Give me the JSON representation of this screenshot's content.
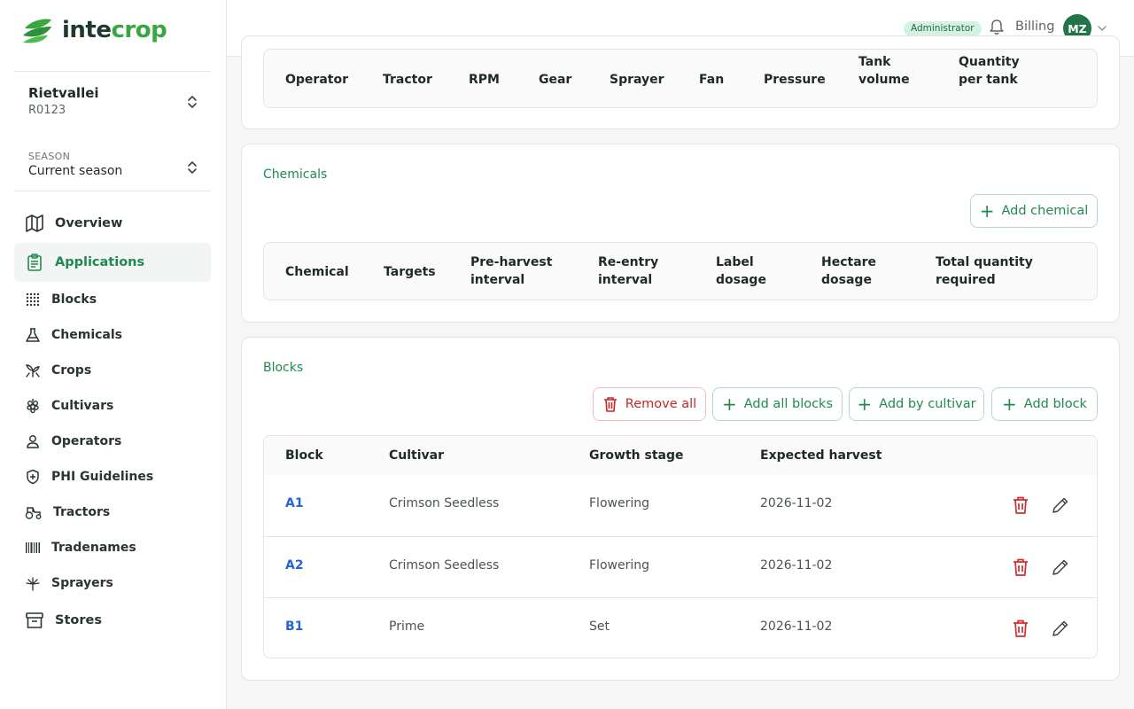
{
  "app": {
    "logo": {
      "prefix": "inte",
      "suffix": "crop"
    }
  },
  "sidebar": {
    "farm": {
      "name": "Rietvallei",
      "code": "R0123"
    },
    "season": {
      "label": "SEASON",
      "value": "Current season"
    },
    "items": [
      {
        "label": "Overview",
        "icon": "map-icon"
      },
      {
        "label": "Applications",
        "icon": "clipboard-icon",
        "active": true
      },
      {
        "label": "Blocks",
        "icon": "grid-icon"
      },
      {
        "label": "Chemicals",
        "icon": "flask-icon"
      },
      {
        "label": "Crops",
        "icon": "sprout-icon"
      },
      {
        "label": "Cultivars",
        "icon": "grape-icon"
      },
      {
        "label": "Operators",
        "icon": "user-icon"
      },
      {
        "label": "PHI Guidelines",
        "icon": "shield-icon"
      },
      {
        "label": "Tractors",
        "icon": "tractor-icon"
      },
      {
        "label": "Tradenames",
        "icon": "barcode-icon"
      },
      {
        "label": "Sprayers",
        "icon": "sprayer-icon"
      },
      {
        "label": "Stores",
        "icon": "archive-icon"
      }
    ]
  },
  "topbar": {
    "role_badge": "Administrator",
    "billing": "Billing",
    "avatar_initials": "MZ"
  },
  "equipment": {
    "columns": [
      "Operator",
      "Tractor",
      "RPM",
      "Gear",
      "Sprayer",
      "Fan",
      "Pressure",
      "Tank\nvolume",
      "Quantity\nper tank"
    ]
  },
  "chemicals": {
    "title": "Chemicals",
    "add_label": "Add chemical",
    "columns": [
      "Chemical",
      "Targets",
      "Pre-harvest\ninterval",
      "Re-entry\ninterval",
      "Label\ndosage",
      "Hectare\ndosage",
      "Total quantity\nrequired"
    ]
  },
  "blocks": {
    "title": "Blocks",
    "buttons": {
      "remove_all": "Remove all",
      "add_all": "Add all blocks",
      "add_by_cultivar": "Add by cultivar",
      "add_block": "Add block"
    },
    "columns": [
      "Block",
      "Cultivar",
      "Growth stage",
      "Expected harvest"
    ],
    "rows": [
      {
        "block": "A1",
        "cultivar": "Crimson Seedless",
        "stage": "Flowering",
        "harvest": "2026-11-02"
      },
      {
        "block": "A2",
        "cultivar": "Crimson Seedless",
        "stage": "Flowering",
        "harvest": "2026-11-02"
      },
      {
        "block": "B1",
        "cultivar": "Prime",
        "stage": "Set",
        "harvest": "2026-11-02"
      }
    ]
  },
  "colors": {
    "brand_green": "#1f8a50",
    "danger": "#c62828",
    "link": "#2563d8"
  }
}
